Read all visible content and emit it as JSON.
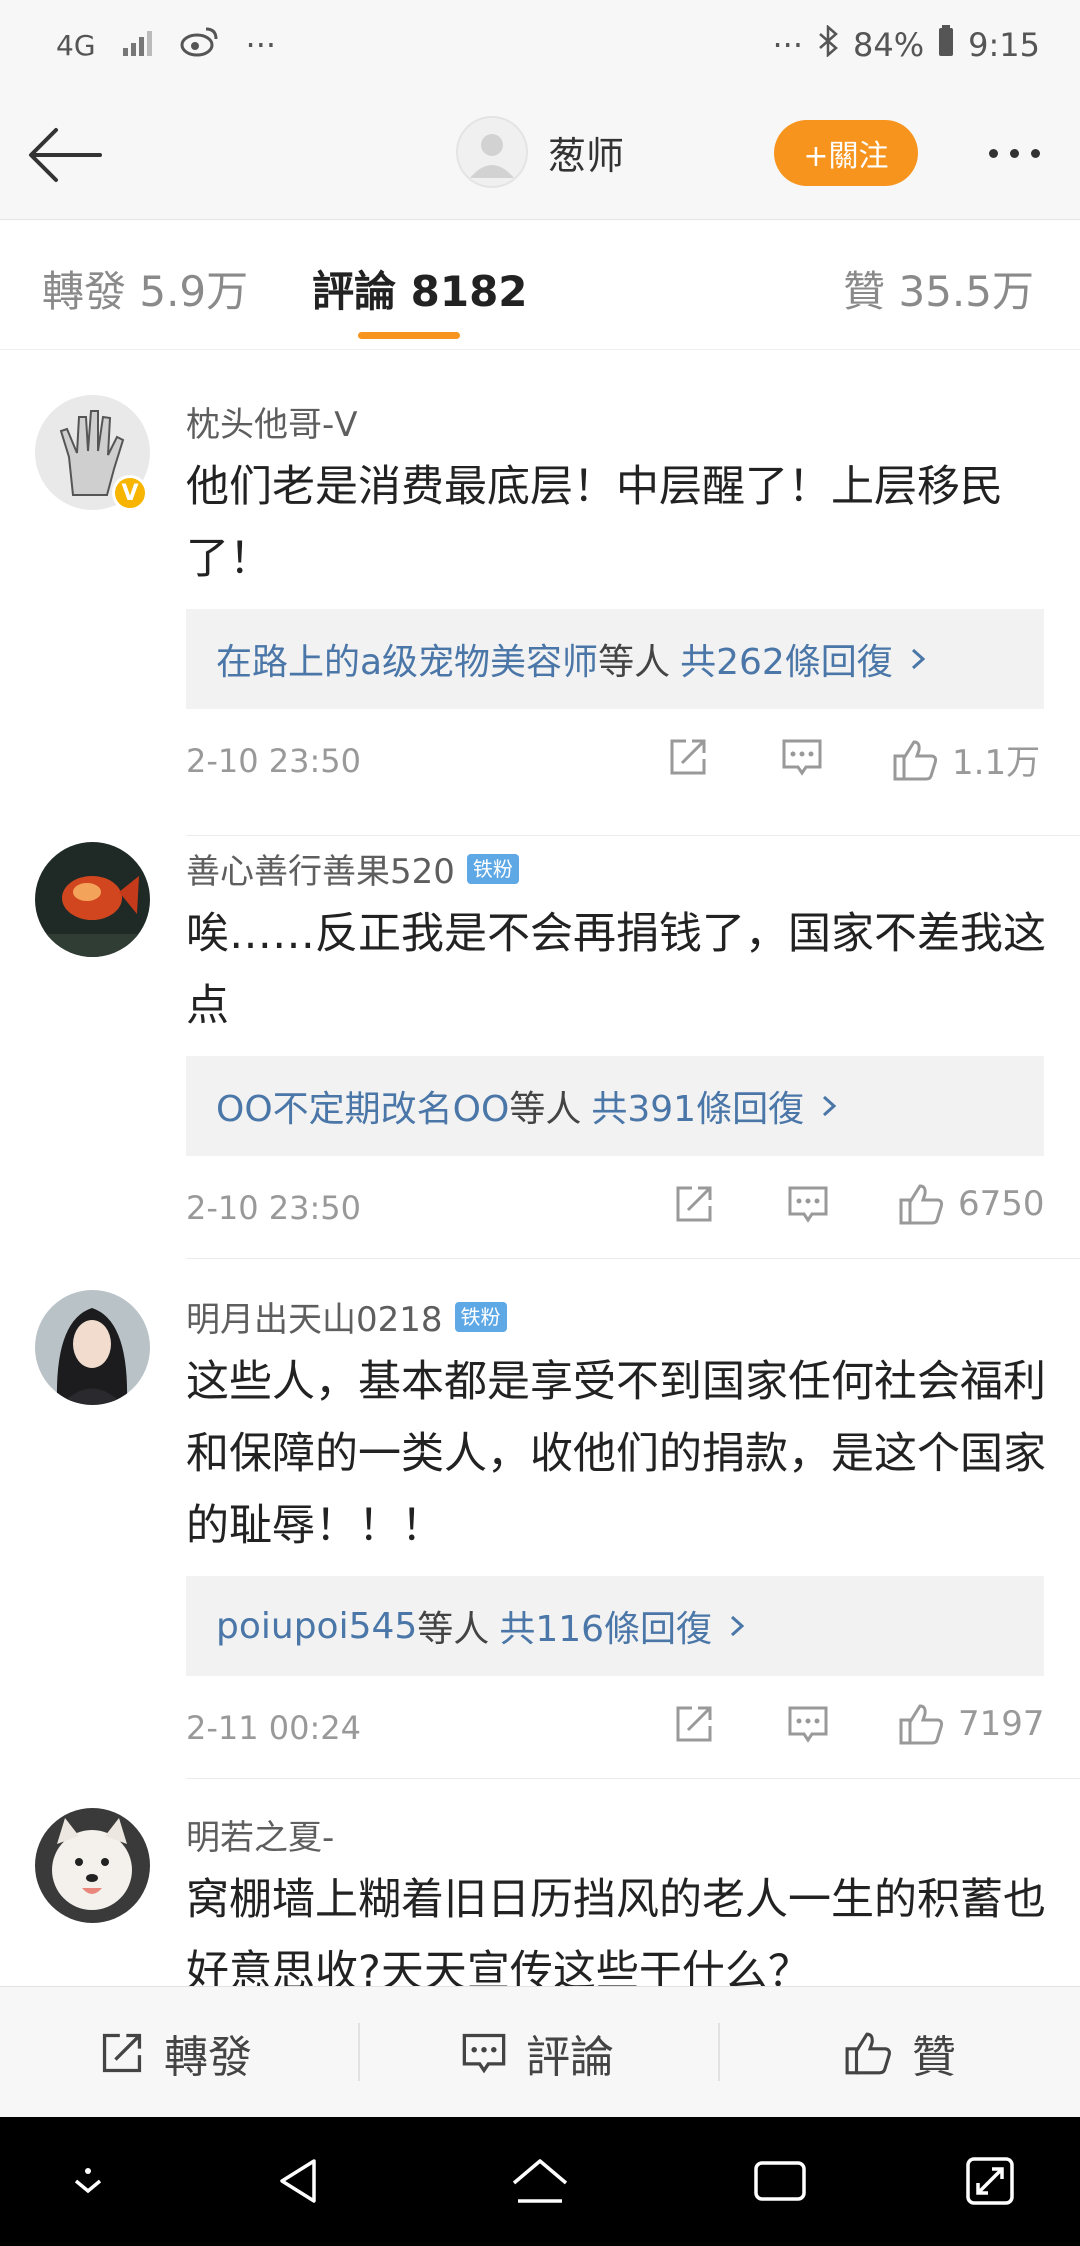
{
  "status_bar": {
    "network": "4G",
    "dots_left": "···",
    "dots_right": "···",
    "battery": "84%",
    "time": "9:15"
  },
  "header": {
    "username": "葱师",
    "follow_label": "+關注"
  },
  "tabs": {
    "repost": "轉發 5.9万",
    "comments": "評論 8182",
    "likes": "贊 35.5万"
  },
  "comments": [
    {
      "username": "枕头他哥-V",
      "badge": "",
      "verified": true,
      "text": "他们老是消费最底层！中层醒了！上层移民了！",
      "reply_users": "在路上的a级宠物美容师",
      "reply_mid": "等人",
      "reply_count": "共262條回復",
      "time": "2-10 23:50",
      "likes": "1.1万"
    },
    {
      "username": "善心善行善果520",
      "badge": "铁粉",
      "verified": false,
      "text": "唉……反正我是不会再捐钱了，国家不差我这点",
      "reply_users": "OO不定期改名OO",
      "reply_mid": "等人",
      "reply_count": "共391條回復",
      "time": "2-10 23:50",
      "likes": "6750"
    },
    {
      "username": "明月出天山0218",
      "badge": "铁粉",
      "verified": false,
      "text": "这些人，基本都是享受不到国家任何社会福利和保障的一类人，收他们的捐款，是这个国家的耻辱！！！",
      "reply_users": "poiupoi545",
      "reply_mid": "等人",
      "reply_count": "共116條回復",
      "time": "2-11 00:24",
      "likes": "7197"
    },
    {
      "username": "明若之夏-",
      "badge": "",
      "verified": false,
      "text": "窝棚墙上糊着旧日历挡风的老人一生的积蓄也好意思收?天天宣传这些干什么？"
    }
  ],
  "action_bar": {
    "repost": "轉發",
    "comment": "評論",
    "like": "贊"
  },
  "icons": {
    "back": "arrow-left-icon",
    "more": "more-dots-icon",
    "share": "share-icon",
    "comment": "comment-icon",
    "like": "thumbs-up-icon",
    "verified": "verified-v-icon"
  },
  "colors": {
    "accent": "#f7941d",
    "link": "#4a76a8",
    "badge": "#5ea8e6",
    "verified": "#f7b500"
  }
}
